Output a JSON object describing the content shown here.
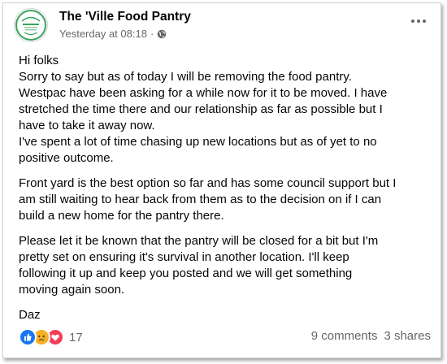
{
  "post": {
    "page_name": "The 'Ville Food Pantry",
    "timestamp": "Yesterday at 08:18",
    "separator": "·",
    "privacy_icon": "globe-icon",
    "more_icon": "more-options-icon",
    "paragraphs": [
      [
        "Hi folks",
        "Sorry to say but as of today I will be removing the food pantry.",
        "Westpac have been asking for a while now for it to be moved. I have",
        "stretched the time there and our relationship as far as possible but I",
        "have to take it away now.",
        "I've spent a lot of time chasing up new locations but as of yet to no",
        "positive outcome."
      ],
      [
        "Front yard is the best option so far and has some council support but I",
        "am still waiting to hear back from them as to the decision on if I can",
        "build a new home for the pantry there."
      ],
      [
        "Please let it be known that the pantry will be closed for a bit but I'm",
        "pretty set on ensuring it's survival in another location. I'll keep",
        "following it up and keep you posted and we will get something",
        "moving again soon."
      ],
      [
        "Daz"
      ]
    ]
  },
  "footer": {
    "reactions": [
      "like-icon",
      "sad-icon",
      "love-icon"
    ],
    "reaction_count": "17",
    "comments": "9 comments",
    "shares": "3 shares"
  },
  "colors": {
    "text": "#050505",
    "secondary": "#65676b",
    "like": "#1877f2",
    "sad": "#f7b125",
    "love": "#f33e58",
    "avatar_green": "#3aa35a"
  }
}
